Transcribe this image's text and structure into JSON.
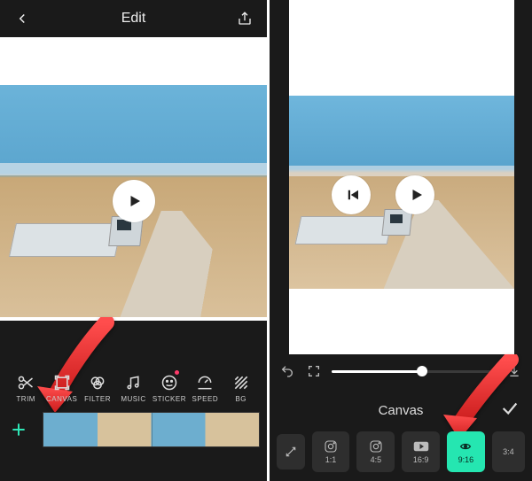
{
  "left": {
    "header": {
      "back": "‹",
      "title": "Edit",
      "share": "share"
    },
    "tools": {
      "trim": "TRIM",
      "canvas": "CANVAS",
      "filter": "FILTER",
      "music": "MUSIC",
      "sticker": "STICKER",
      "speed": "SPEED",
      "bg": "BG"
    },
    "add": "+"
  },
  "right": {
    "canvas_title": "Canvas",
    "ratios": {
      "free": "",
      "r1_1": "1:1",
      "r4_5": "4:5",
      "r16_9": "16:9",
      "r9_16": "9:16",
      "r3_4": "3:4"
    },
    "progress": {
      "pct": 55
    }
  }
}
